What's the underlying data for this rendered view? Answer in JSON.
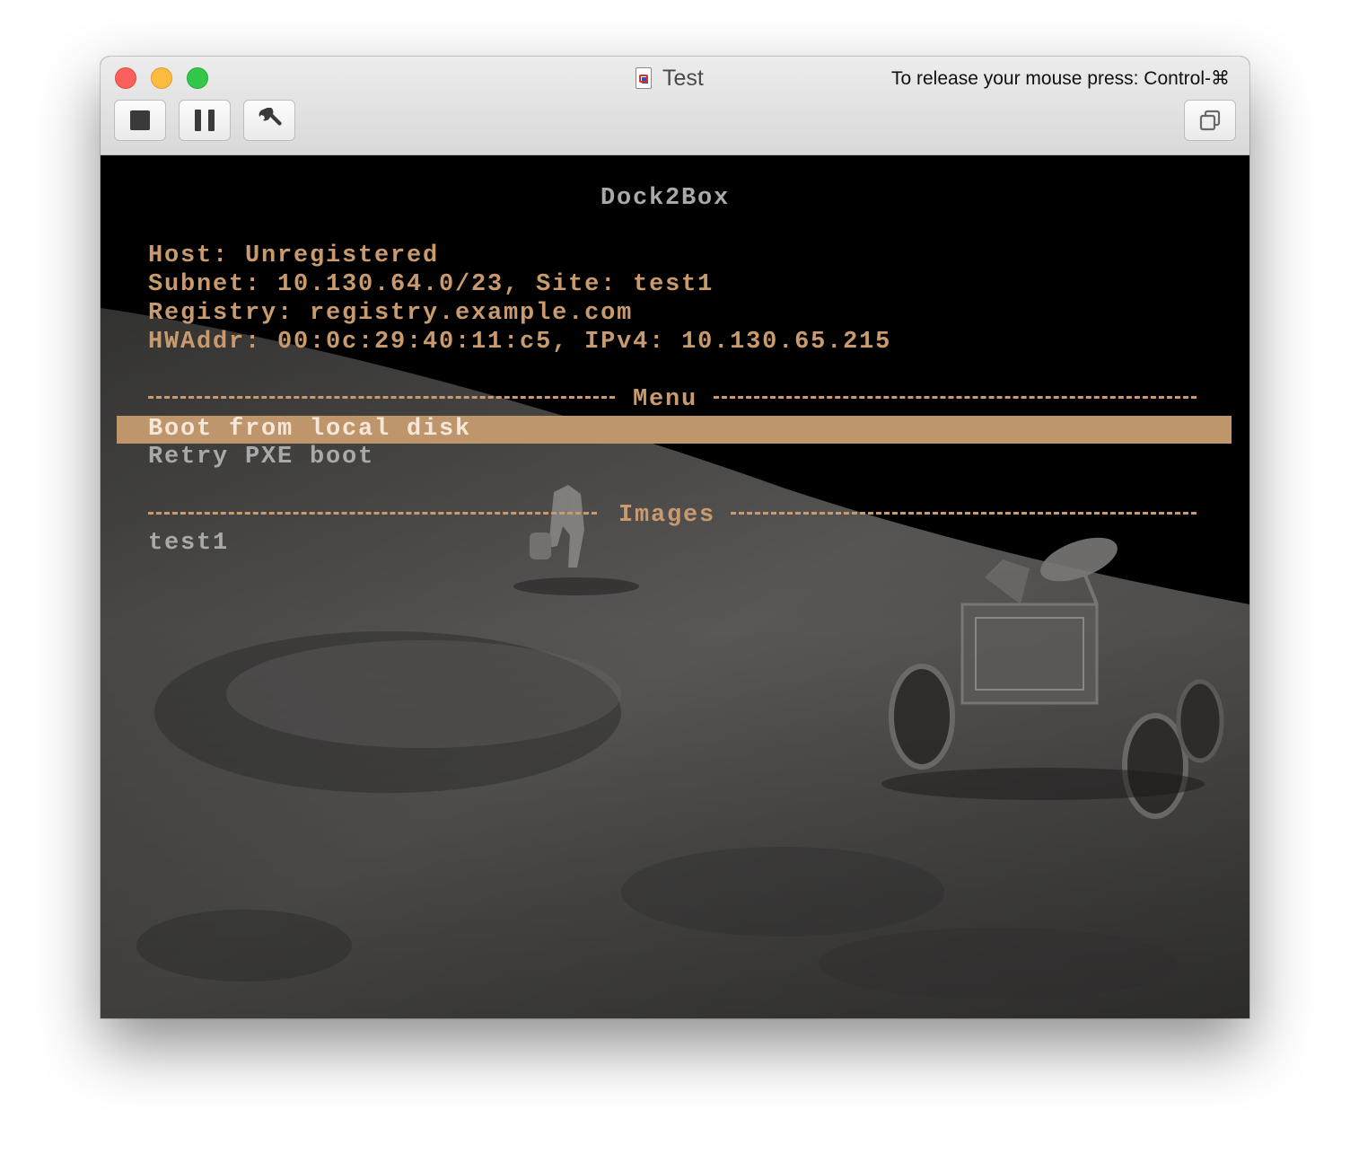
{
  "window": {
    "title": "Test",
    "release_hint": "To release your mouse press: Control-⌘"
  },
  "toolbar": {
    "buttons": [
      {
        "name": "stop",
        "icon": "stop-icon"
      },
      {
        "name": "pause",
        "icon": "pause-icon"
      },
      {
        "name": "settings",
        "icon": "wrench-icon"
      },
      {
        "name": "window-mode",
        "icon": "window-copy-icon"
      }
    ]
  },
  "console": {
    "title": "Dock2Box",
    "host_line": "Host: Unregistered",
    "subnet_line": "Subnet: 10.130.64.0/23, Site: test1",
    "registry_line": "Registry: registry.example.com",
    "hw_line": "HWAddr: 00:0c:29:40:11:c5, IPv4: 10.130.65.215",
    "menu_header": "Menu",
    "menu_items": [
      "Boot from local disk",
      "Retry PXE boot"
    ],
    "selected_index": 0,
    "images_header": "Images",
    "images": [
      "test1"
    ],
    "colors": {
      "text_orange": "#c89a6e",
      "text_gray": "#a9a9a9",
      "highlight": "#bf956b",
      "background": "#000000"
    },
    "background_scene": "lunar-surface-with-astronaut-and-rover"
  }
}
